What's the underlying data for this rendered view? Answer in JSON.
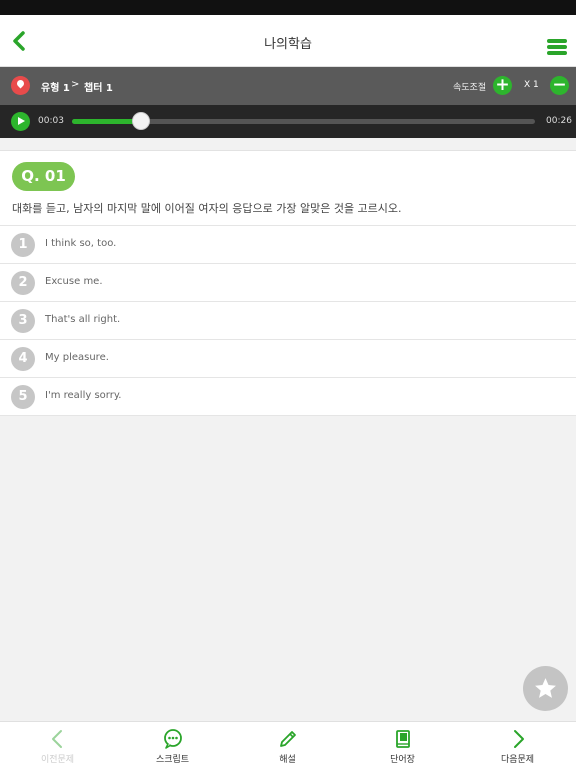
{
  "nav": {
    "title": "나의학습"
  },
  "breadcrumb": {
    "type": "유형 1",
    "separator": ">",
    "chapter": "챕터 1",
    "speed_label": "속도조절",
    "speed_value": "X 1",
    "plus": "+",
    "minus": "−"
  },
  "player": {
    "current_time": "00:03",
    "total_time": "00:26",
    "progress": 0.15
  },
  "question": {
    "number": "Q. 01",
    "prompt": "대화를 듣고, 남자의 마지막 말에 이어질 여자의 응답으로 가장 알맞은 것을 고르시오.",
    "options": [
      {
        "num": "1",
        "text": "I think so, too."
      },
      {
        "num": "2",
        "text": "Excuse me."
      },
      {
        "num": "3",
        "text": "That's all right."
      },
      {
        "num": "4",
        "text": "My pleasure."
      },
      {
        "num": "5",
        "text": "I'm really sorry."
      }
    ]
  },
  "bottom_tabs": [
    {
      "label": "이전문제",
      "icon": "chevron-left-icon",
      "disabled": true
    },
    {
      "label": "스크립트",
      "icon": "speech-bubble-icon"
    },
    {
      "label": "해설",
      "icon": "pencil-icon"
    },
    {
      "label": "단어장",
      "icon": "book-icon"
    },
    {
      "label": "다음문제",
      "icon": "chevron-right-icon"
    }
  ],
  "colors": {
    "accent": "#2db52d",
    "badge": "#7dc552",
    "pin": "#e84b4b"
  }
}
